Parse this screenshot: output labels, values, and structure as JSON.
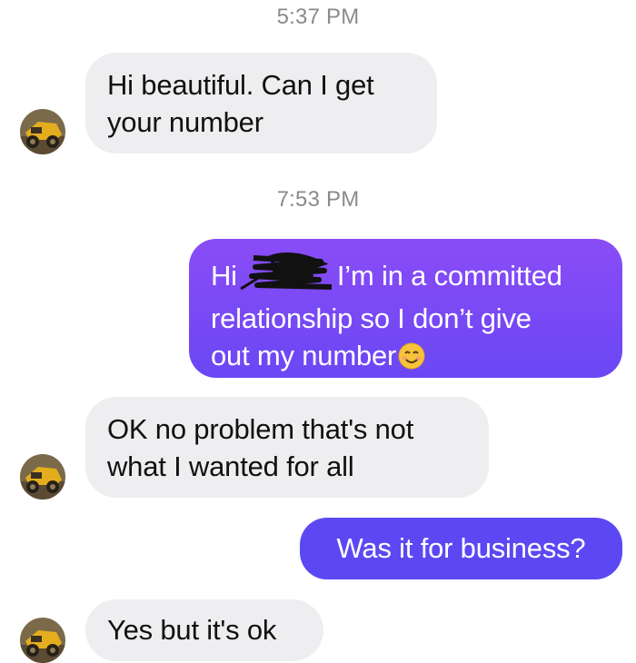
{
  "conversation": {
    "timestamps": [
      "5:37 PM",
      "7:53 PM"
    ],
    "messages": [
      {
        "sender": "them",
        "text": "Hi beautiful. Can I get\nyour number"
      },
      {
        "sender": "me",
        "text_before": "Hi",
        "text_after": "I’m in a committed\nrelationship so I don’t give\nout my number",
        "emoji": "smiling-face-emoji"
      },
      {
        "sender": "them",
        "text": "OK no problem that's not\nwhat I wanted for all"
      },
      {
        "sender": "me",
        "text": "Was it for business?"
      },
      {
        "sender": "them",
        "text": "Yes but it's ok"
      }
    ]
  },
  "colors": {
    "incoming_bubble": "#eeeef0",
    "outgoing_gradient_top": "#8a4cf6",
    "outgoing_gradient_bottom": "#5147f2",
    "timestamp": "#8a8a8e"
  },
  "icons": {
    "avatar": "contact-avatar-icon",
    "redaction": "redaction-scribble-icon",
    "emoji": "smiling-face-emoji"
  }
}
